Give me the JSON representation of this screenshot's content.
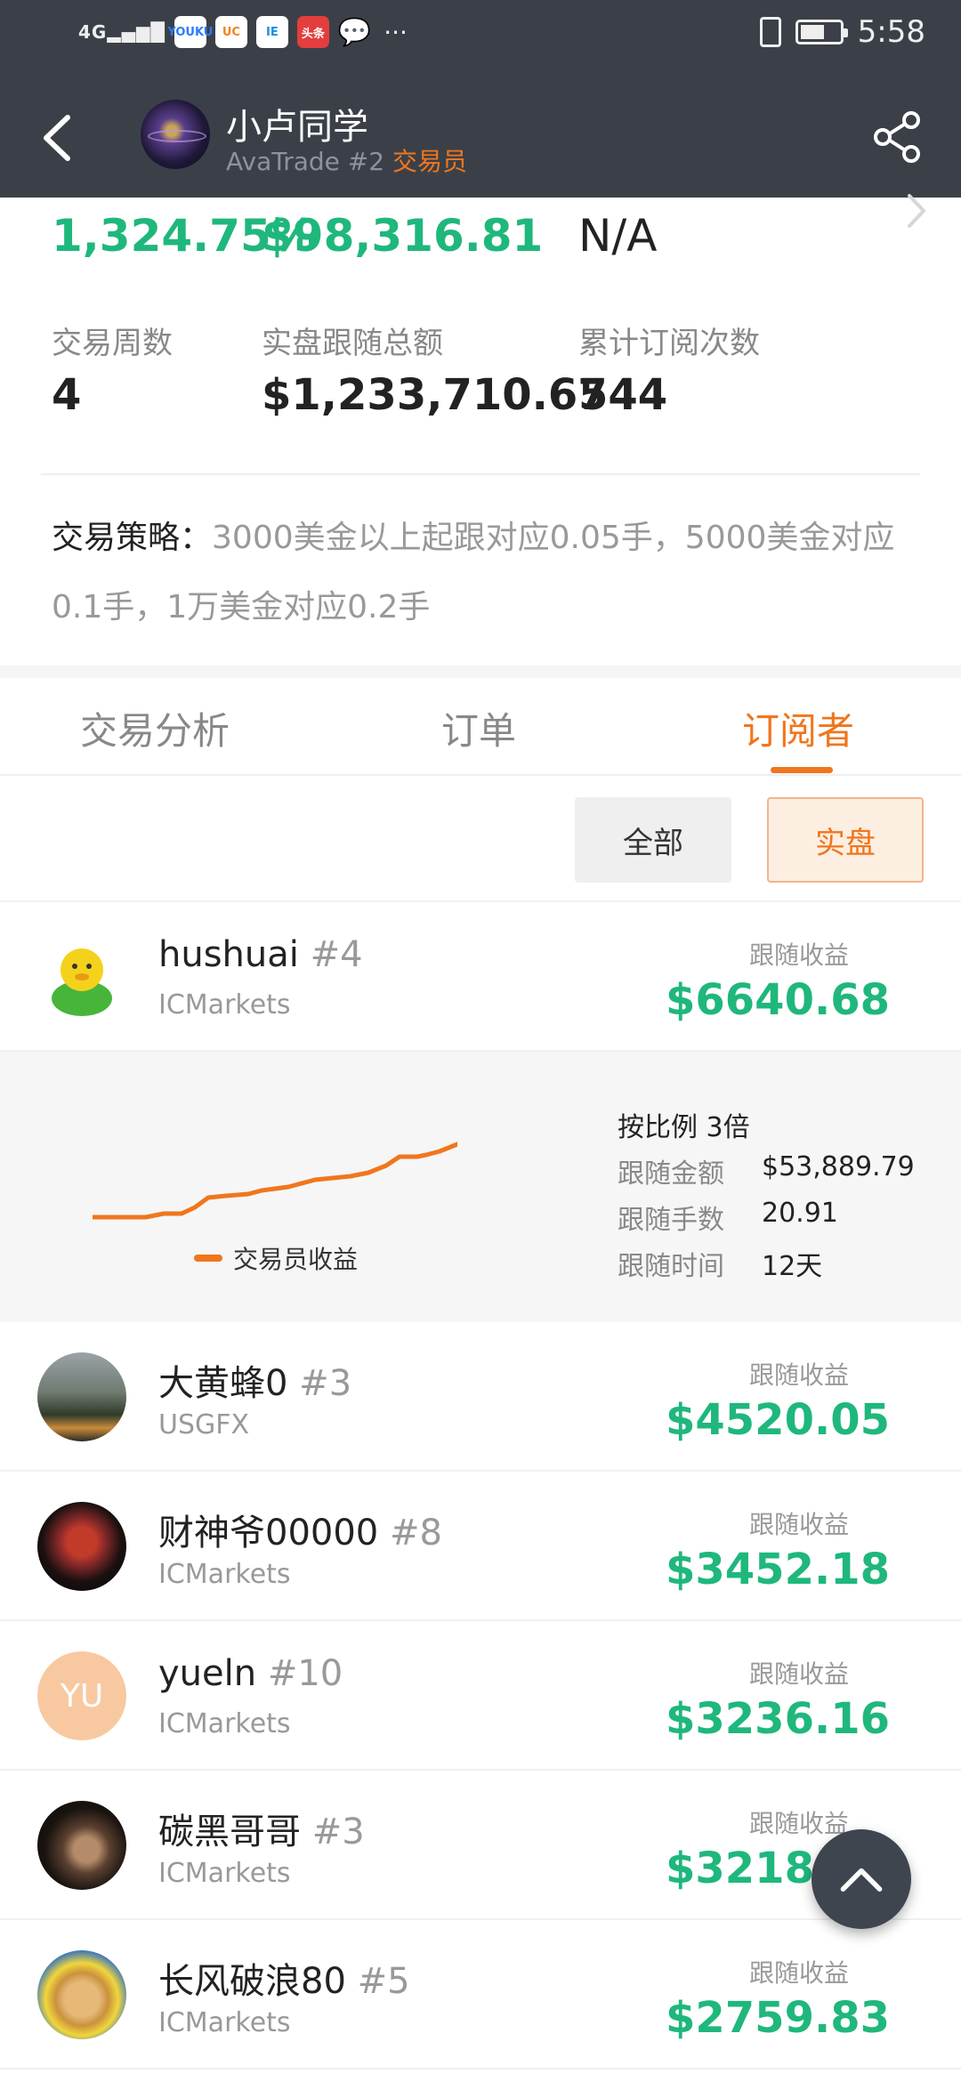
{
  "status_bar": {
    "network": "4G",
    "apps": [
      "YOUKU",
      "UC",
      "IE",
      "头条"
    ],
    "time": "5:58"
  },
  "header": {
    "name": "小卢同学",
    "broker_rank": "AvaTrade #2",
    "role": "交易员"
  },
  "stats_top": {
    "return_pct": "1,324.75%",
    "profit": "$98,316.81",
    "third": "N/A"
  },
  "stats": [
    {
      "label": "交易周数",
      "value": "4"
    },
    {
      "label": "实盘跟随总额",
      "value": "$1,233,710.67"
    },
    {
      "label": "累计订阅次数",
      "value": "544"
    }
  ],
  "strategy": {
    "label": "交易策略：",
    "text": "3000美金以上起跟对应0.05手，5000美金对应0.1手，1万美金对应0.2手"
  },
  "tabs": [
    "交易分析",
    "订单",
    "订阅者"
  ],
  "active_tab": "订阅者",
  "filters": {
    "all": "全部",
    "real": "实盘"
  },
  "profit_label": "跟随收益",
  "subscribers": [
    {
      "name": "hushuai",
      "rank": "#4",
      "broker": "ICMarkets",
      "amount": "$6640.68"
    },
    {
      "name": "大黄蜂0",
      "rank": "#3",
      "broker": "USGFX",
      "amount": "$4520.05"
    },
    {
      "name": "财神爷00000",
      "rank": "#8",
      "broker": "ICMarkets",
      "amount": "$3452.18"
    },
    {
      "name": "yueln",
      "rank": "#10",
      "broker": "ICMarkets",
      "amount": "$3236.16",
      "initials": "YU"
    },
    {
      "name": "碳黑哥哥",
      "rank": "#3",
      "broker": "ICMarkets",
      "amount": "$3218.66"
    },
    {
      "name": "长风破浪80",
      "rank": "#5",
      "broker": "ICMarkets",
      "amount": "$2759.83"
    }
  ],
  "detail": {
    "ratio": "按比例 3倍",
    "rows": [
      {
        "label": "跟随金额",
        "value": "$53,889.79"
      },
      {
        "label": "跟随手数",
        "value": "20.91"
      },
      {
        "label": "跟随时间",
        "value": "12天"
      }
    ],
    "legend": "交易员收益",
    "series_color": "#f0761d"
  },
  "colors": {
    "accent": "#f0761d",
    "profit": "#1fb77c",
    "header_bg": "#3b4048"
  }
}
